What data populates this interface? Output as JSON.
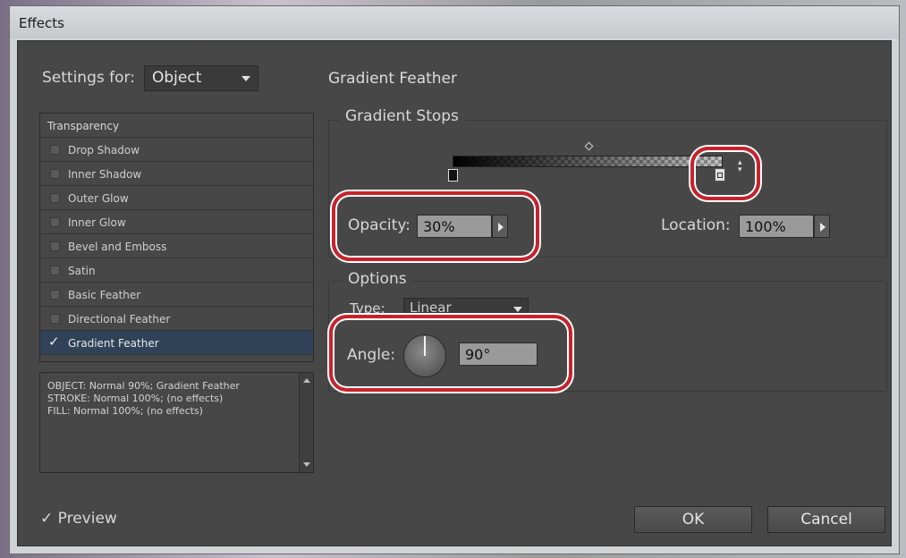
{
  "window": {
    "title": "Effects"
  },
  "settings": {
    "label": "Settings for:",
    "value": "Object"
  },
  "section": {
    "title": "Gradient Feather"
  },
  "effects_list": {
    "header": "Transparency",
    "items": [
      {
        "label": "Drop Shadow",
        "checked": false
      },
      {
        "label": "Inner Shadow",
        "checked": false
      },
      {
        "label": "Outer Glow",
        "checked": false
      },
      {
        "label": "Inner Glow",
        "checked": false
      },
      {
        "label": "Bevel and Emboss",
        "checked": false
      },
      {
        "label": "Satin",
        "checked": false
      },
      {
        "label": "Basic Feather",
        "checked": false
      },
      {
        "label": "Directional Feather",
        "checked": false
      },
      {
        "label": "Gradient Feather",
        "checked": true
      }
    ]
  },
  "summary": {
    "lines": [
      "OBJECT: Normal 90%; Gradient Feather",
      "STROKE: Normal 100%; (no effects)",
      "FILL: Normal 100%; (no effects)"
    ]
  },
  "gradient_stops": {
    "title": "Gradient Stops",
    "opacity_label": "Opacity:",
    "opacity_value": "30%",
    "location_label": "Location:",
    "location_value": "100%"
  },
  "options": {
    "title": "Options",
    "type_label": "Type:",
    "type_value": "Linear",
    "angle_label": "Angle:",
    "angle_value": "90°"
  },
  "footer": {
    "preview_label": "Preview",
    "preview_checked": true,
    "ok_label": "OK",
    "cancel_label": "Cancel"
  },
  "colors": {
    "annotation_highlight": "#c8232d",
    "dialog_bg": "#474747",
    "selected_row": "#2f4257"
  }
}
